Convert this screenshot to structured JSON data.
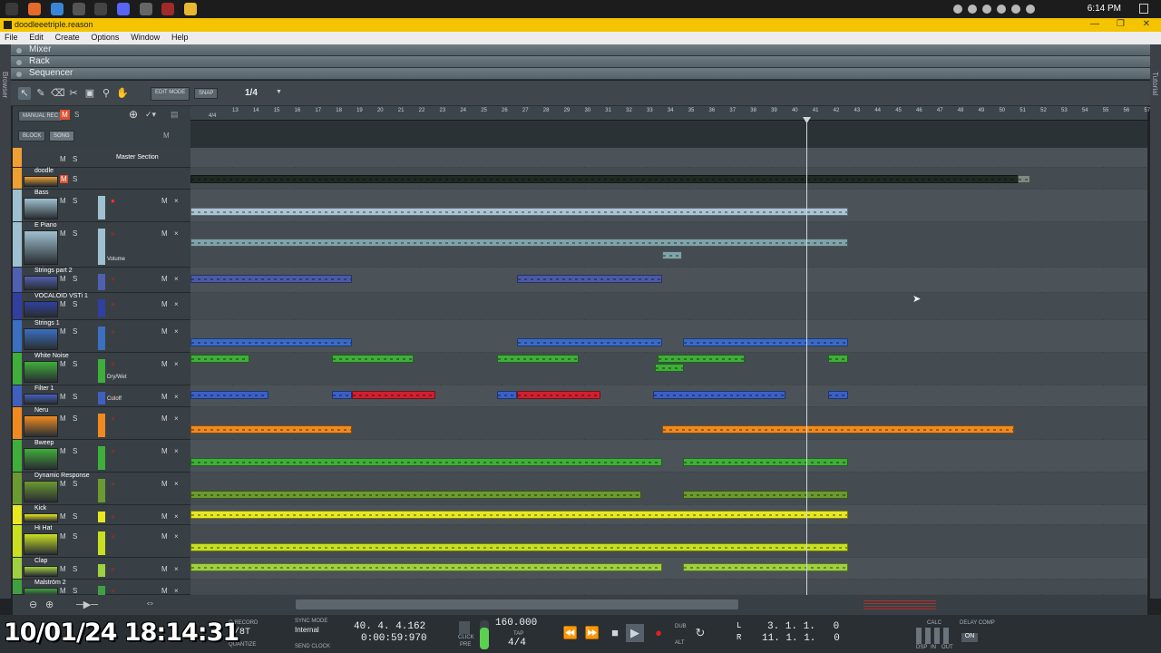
{
  "taskbar": {
    "clock": "6:14 PM"
  },
  "window": {
    "title": "doodleeetriple.reason"
  },
  "menu": [
    "File",
    "Edit",
    "Create",
    "Options",
    "Window",
    "Help"
  ],
  "panels": {
    "mixer": "Mixer",
    "rack": "Rack",
    "sequencer": "Sequencer"
  },
  "side_labels": {
    "left": "Browser",
    "right": "Tutorial"
  },
  "toolbar": {
    "edit_mode": "EDIT MODE",
    "snap": "SNAP",
    "quantize": "1/4",
    "manual_rec": "MANUAL REC",
    "block": "BLOCK",
    "song": "SONG"
  },
  "ruler_ticks": [
    "13",
    "14",
    "15",
    "16",
    "17",
    "18",
    "19",
    "20",
    "21",
    "22",
    "23",
    "24",
    "25",
    "26",
    "27",
    "28",
    "29",
    "30",
    "31",
    "32",
    "33",
    "34",
    "35",
    "36",
    "37",
    "38",
    "39",
    "40",
    "41",
    "42",
    "43",
    "44",
    "45",
    "46",
    "47",
    "48",
    "49",
    "50",
    "51",
    "52",
    "53",
    "54",
    "55",
    "56",
    "57"
  ],
  "ruler_sub": "4/4",
  "tracks": [
    {
      "name": "Master Section",
      "color": "#f0a030"
    },
    {
      "name": "doodle",
      "color": "#f0a030"
    },
    {
      "name": "Bass",
      "color": "#9fc0d0"
    },
    {
      "name": "E Piano",
      "color": "#9fc0d0",
      "sub": "Volume"
    },
    {
      "name": "Strings part 2",
      "color": "#5060b0"
    },
    {
      "name": "VOCALOID VSTi 1",
      "color": "#3040a0"
    },
    {
      "name": "Strings 1",
      "color": "#3b6fc0"
    },
    {
      "name": "White Noise",
      "color": "#3fae3a",
      "sub": "Dry/Wet"
    },
    {
      "name": "Filter 1",
      "color": "#3f60c0",
      "sub": "Cutoff"
    },
    {
      "name": "Neru",
      "color": "#f08a20"
    },
    {
      "name": "Bweep",
      "color": "#3fae3a"
    },
    {
      "name": "Dynamic Response",
      "color": "#6a9a30"
    },
    {
      "name": "Kick",
      "color": "#e8e820"
    },
    {
      "name": "Hi Hat",
      "color": "#c8e020"
    },
    {
      "name": "Clap",
      "color": "#a0d040"
    },
    {
      "name": "Malström 2",
      "color": "#40a040"
    }
  ],
  "track_buttons": {
    "mute": "M",
    "solo": "S"
  },
  "transport": {
    "q_record": "Q RECORD",
    "quantize_val": "1/8T",
    "quantize_lbl": "QUANTIZE",
    "sync_mode": "SYNC MODE",
    "sync_val": "Internal",
    "send_clock": "SEND CLOCK",
    "position": "40. 4. 4.162",
    "time": "0:00:59:970",
    "tempo": "160.000",
    "signature": "4/4",
    "tap": "TAP",
    "click": "CLICK",
    "pre": "PRE",
    "dub": "DUB",
    "alt": "ALT",
    "loop_l_label": "L",
    "loop_r_label": "R",
    "loop_left": "3. 1. 1.   0",
    "loop_right": "11. 1. 1.   0",
    "delay_comp": "DELAY COMP",
    "delay_on": "ON",
    "calc": "CALC",
    "dsp": "DSP",
    "in": "IN",
    "out": "OUT"
  },
  "overlay_timestamp": "10/01/24 18:14:31"
}
